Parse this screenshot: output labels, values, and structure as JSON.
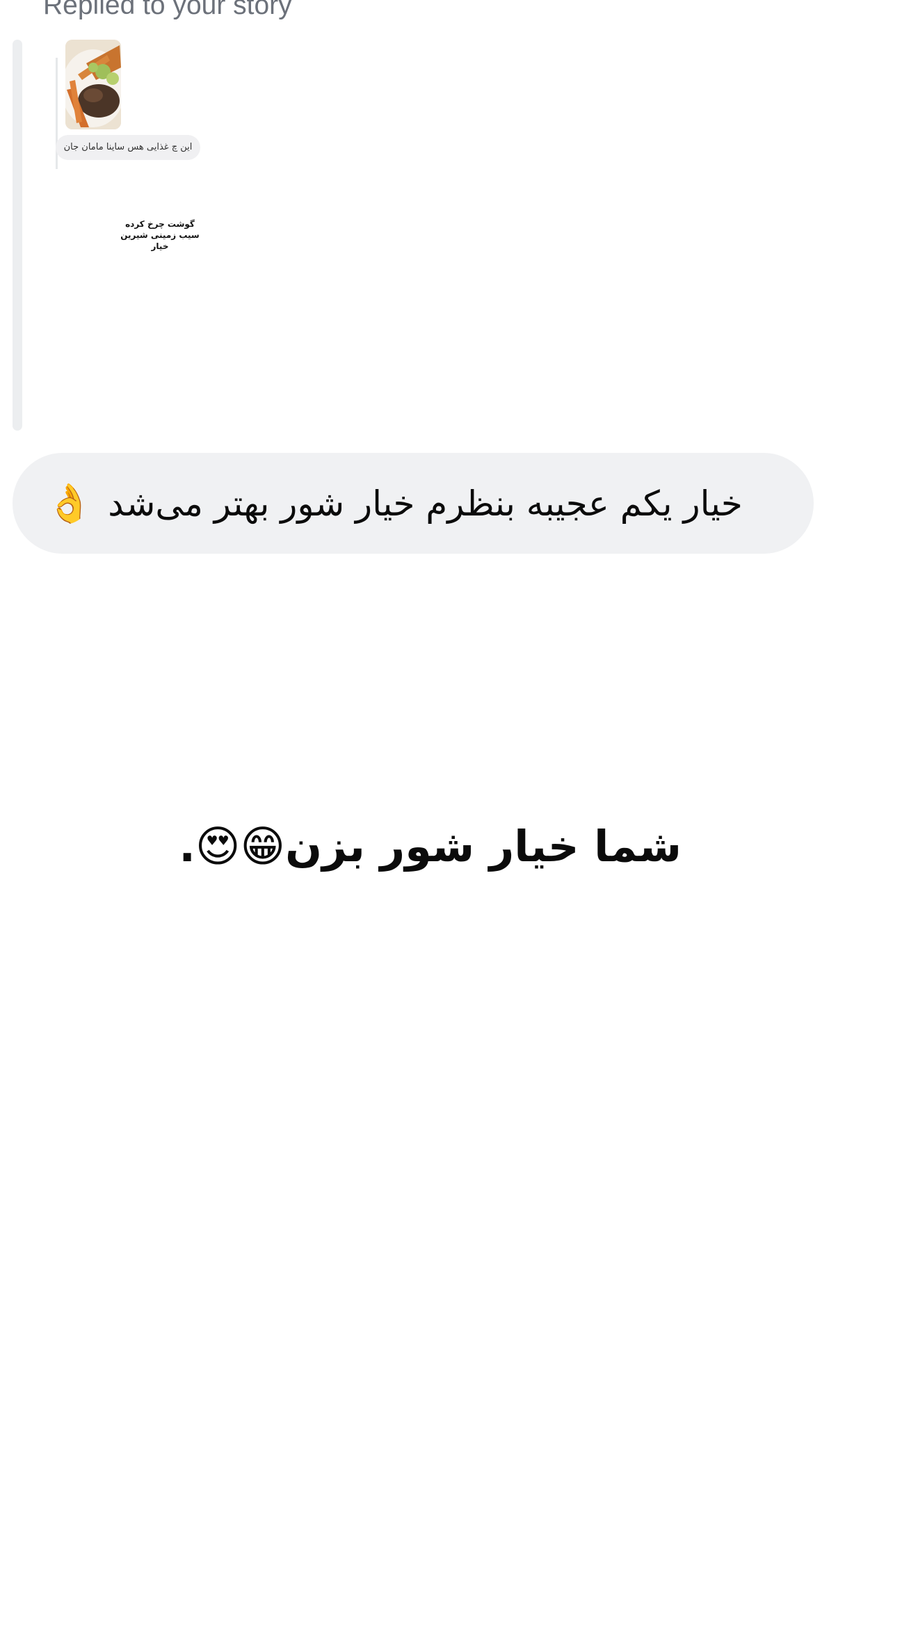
{
  "header": {
    "replied_label": "Replied to your story"
  },
  "story_preview": {
    "caption": "این چ غذایی هس ساینا مامان جان",
    "text_lines": [
      "گوشت چرخ کرده",
      "سیب زمینی شیرین",
      "خیار"
    ],
    "thumbnail_icon": "food-plate-photo"
  },
  "message": {
    "text": "خیار یکم عجیبه بنظرم خیار شور بهتر می‌شد",
    "emoji": "👌"
  },
  "story_overlay": {
    "text": "شما خیار شور بزن😁😍."
  }
}
